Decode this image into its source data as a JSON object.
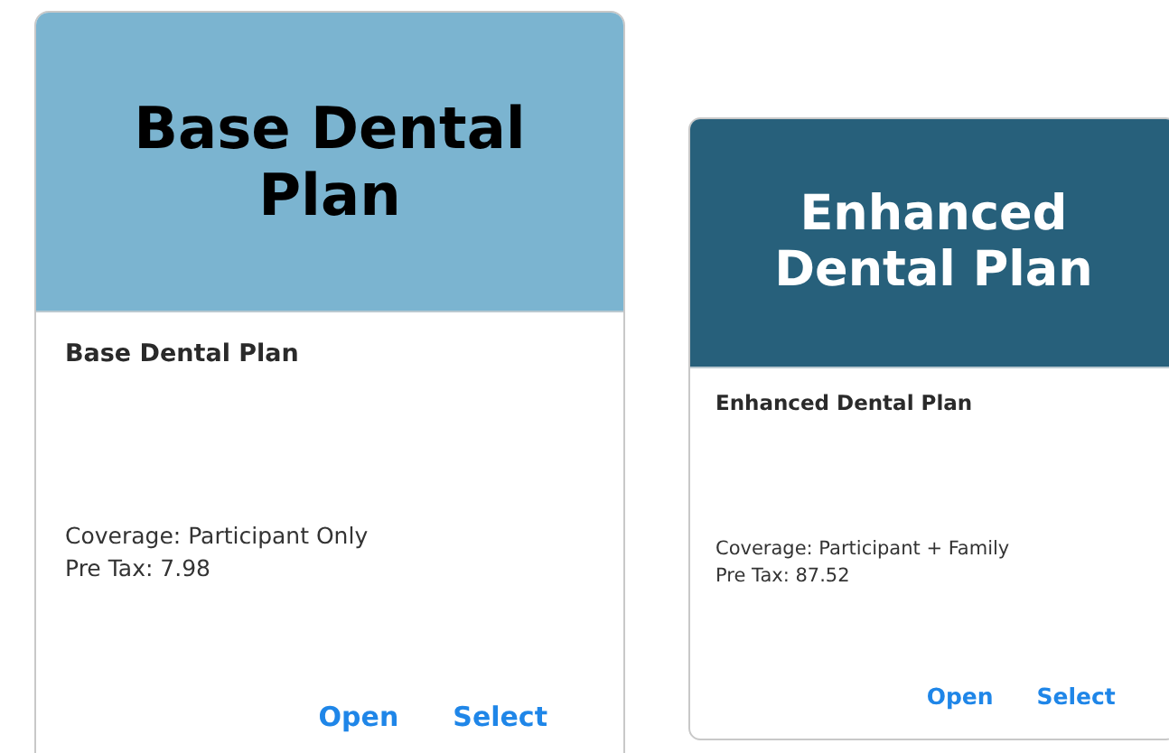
{
  "plans": [
    {
      "banner": "Base Dental Plan",
      "color": "#7bb4d0",
      "title": "Base Dental Plan",
      "coverage": "Coverage: Participant Only",
      "pre_tax": "Pre Tax: 7.98",
      "actions": [
        "Open",
        "Select"
      ]
    },
    {
      "banner": "Enhanced Dental Plan",
      "color": "#27607b",
      "title": "Enhanced Dental Plan",
      "coverage": "Coverage: Participant + Family",
      "pre_tax": "Pre Tax: 87.52",
      "actions": [
        "Open",
        "Select"
      ]
    }
  ]
}
